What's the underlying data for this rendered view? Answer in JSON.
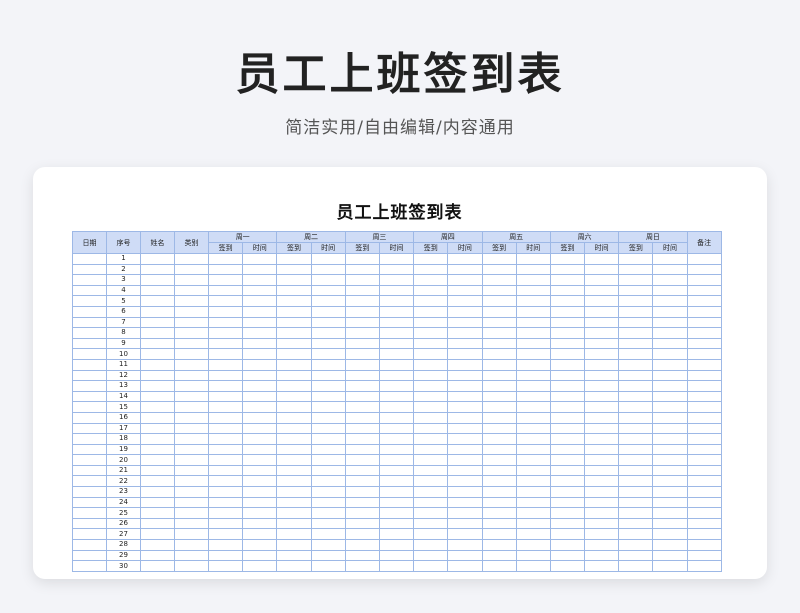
{
  "page": {
    "title": "员工上班签到表",
    "subtitle": "简洁实用/自由编辑/内容通用"
  },
  "sheet": {
    "title": "员工上班签到表",
    "headers": {
      "date": "日期",
      "seq": "序号",
      "name": "姓名",
      "category": "类别",
      "remark": "备注",
      "days": [
        "周一",
        "周二",
        "周三",
        "周四",
        "周五",
        "周六",
        "周日"
      ],
      "sign": "签到",
      "time": "时间"
    },
    "rows": [
      "1",
      "2",
      "3",
      "4",
      "5",
      "6",
      "7",
      "8",
      "9",
      "10",
      "11",
      "12",
      "13",
      "14",
      "15",
      "16",
      "17",
      "18",
      "19",
      "20",
      "21",
      "22",
      "23",
      "24",
      "25",
      "26",
      "27",
      "28",
      "29",
      "30"
    ]
  },
  "colors": {
    "background": "#f3f4f8",
    "header_fill": "#cfdcf6",
    "grid_line": "#9db8e6"
  }
}
